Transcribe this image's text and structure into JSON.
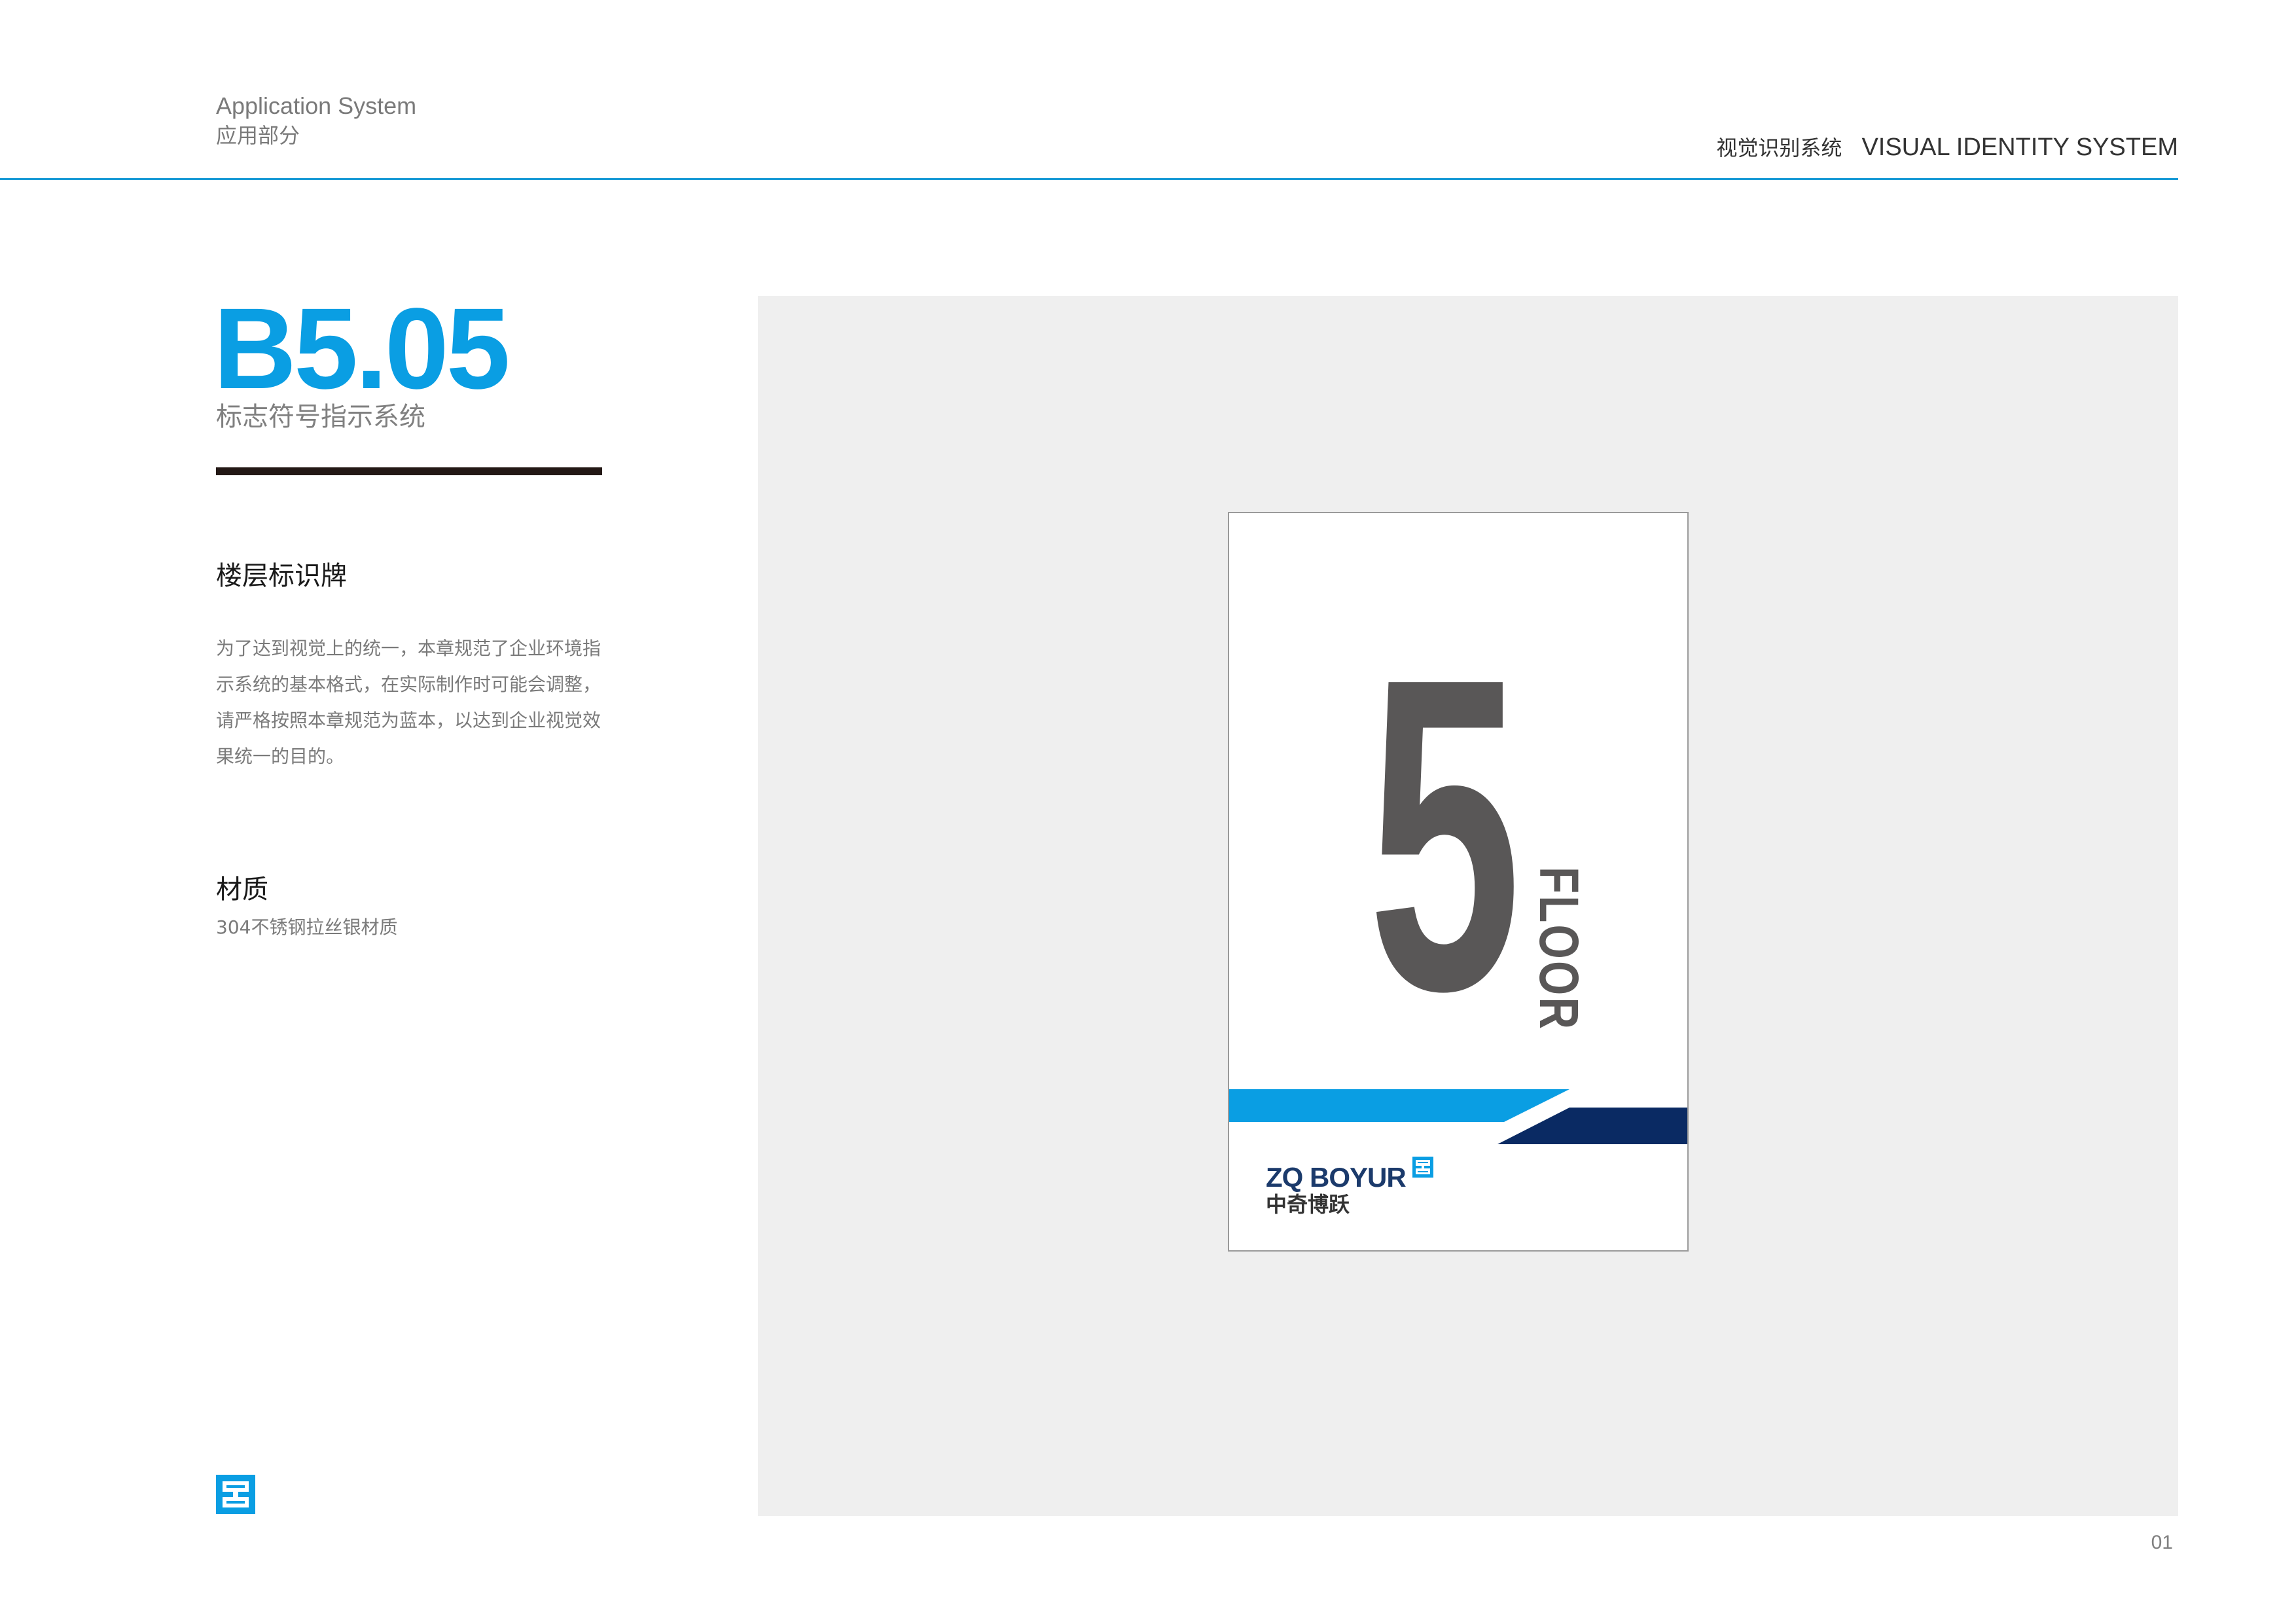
{
  "header": {
    "section_en": "Application System",
    "section_cn": "应用部分",
    "system_cn": "视觉识别系统",
    "system_en": "VISUAL IDENTITY SYSTEM"
  },
  "content": {
    "code": "B5.05",
    "subtitle": "标志符号指示系统",
    "section1_title": "楼层标识牌",
    "section1_text": "为了达到视觉上的统一，本章规范了企业环境指示系统的基本格式，在实际制作时可能会调整，请严格按照本章规范为蓝本，以达到企业视觉效果统一的目的。",
    "section2_title": "材质",
    "section2_text": "304不锈钢拉丝银材质"
  },
  "sign": {
    "floor_number": "5",
    "floor_label": "FLOOR",
    "brand_en": "ZQ BOYUR",
    "brand_cn": "中奇博跃"
  },
  "footer": {
    "page_number": "01"
  },
  "colors": {
    "accent_blue": "#0a9ee3",
    "navy": "#0a2a63",
    "sign_gray": "#595757",
    "panel_bg": "#efefef"
  },
  "icons": {
    "brand_logo": "zq-logo-icon"
  }
}
